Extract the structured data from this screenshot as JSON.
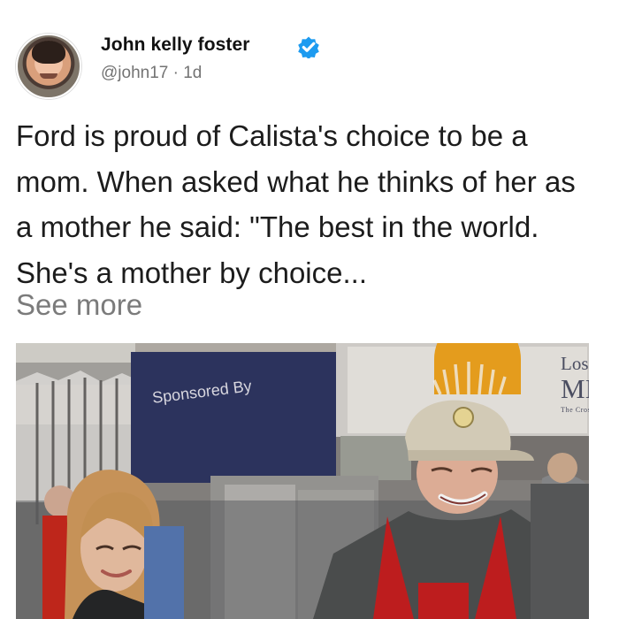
{
  "tweet": {
    "author": {
      "name": "John kelly foster",
      "handle": "@john17",
      "time": "1d",
      "verified": true,
      "verified_color": "#1d9bf0"
    },
    "text": "Ford is proud of Calista's choice to be a mom. When asked what he thinks of her as a mother he said: \"The best in the world. She's a mother by choice...",
    "see_more_label": "See more"
  },
  "photo": {
    "banner_text": "Sponsored By",
    "logo_text": {
      "line1": "Los A",
      "line2": "MIS",
      "line3": "The Cross"
    }
  },
  "colors": {
    "text_primary": "#1c1c1c",
    "text_secondary": "#737373",
    "apron_red": "#c81f20"
  }
}
